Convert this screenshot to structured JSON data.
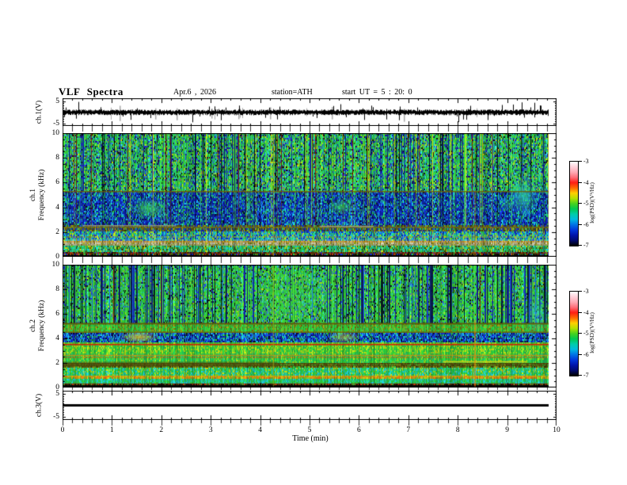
{
  "header": {
    "title": "VLF Spectra",
    "date": "Apr.6 , 2026",
    "station": "station=ATH",
    "start_ut": "start UT =  5 : 20: 0"
  },
  "time_axis": {
    "label": "Time  (min)",
    "min": 0,
    "max": 10,
    "ticks": [
      "0",
      "1",
      "2",
      "3",
      "4",
      "5",
      "6",
      "7",
      "8",
      "9",
      "10"
    ],
    "minor_step_min": 0.2
  },
  "panels": {
    "wave": {
      "ylabel": "ch.1(V)",
      "yticks": [
        "5",
        "-5"
      ],
      "ylim": [
        -5,
        5
      ]
    },
    "sg1": {
      "ylabel_ch": "ch.1",
      "ylabel_axis": "Frequency  (kHz)",
      "yticks": [
        "10",
        "8",
        "6",
        "4",
        "2",
        "0"
      ],
      "ylim": [
        0,
        10
      ]
    },
    "sg2": {
      "ylabel_ch": "ch.2",
      "ylabel_axis": "Frequency  (kHz)",
      "yticks": [
        "10",
        "8",
        "6",
        "4",
        "2",
        "0"
      ],
      "ylim": [
        0,
        10
      ]
    },
    "ch3": {
      "ylabel": "ch.3(V)",
      "yticks": [
        "5",
        "-5"
      ],
      "ylim": [
        -5,
        5
      ]
    }
  },
  "colorbar": {
    "label": "log(PSD)(V²/Hz)",
    "ticks": [
      "-3",
      "-4",
      "-5",
      "-6",
      "-7"
    ],
    "gradient": [
      "#ffffff",
      "#ffd2dc",
      "#ffaab4",
      "#ff6e78",
      "#ff1e14",
      "#ff6a00",
      "#ffd000",
      "#b4e100",
      "#46d21e",
      "#00c850",
      "#00cdaa",
      "#00b9e1",
      "#0073e6",
      "#0037dc",
      "#0014aa",
      "#000a6e",
      "#000000"
    ]
  },
  "chart_data": [
    {
      "id": "ch1_waveform",
      "type": "line",
      "ylabel": "ch.1(V)",
      "xlim": [
        0,
        10
      ],
      "ylim": [
        -5,
        5
      ],
      "description": "Broadband noise around 0 V, ~±1 V, with impulsive spikes to ±4 V and grey saturation bars; data ends at ~9.85 min",
      "seed": 303,
      "gray_spikes_t": [
        1.15,
        1.87,
        2.3,
        3.02,
        3.55,
        4.2,
        5.45,
        6.9
      ],
      "down_spikes_t": [
        2.63,
        3.2,
        4.35,
        6.55,
        8.02,
        8.6
      ],
      "up_spikes_t": [
        0.32,
        5.62,
        8.9,
        9.12,
        9.3,
        9.55,
        9.67
      ]
    },
    {
      "id": "ch1_spectrogram",
      "type": "heatmap",
      "xlim": [
        0,
        10
      ],
      "ylim": [
        0,
        10
      ],
      "colorbar_ticks": [
        -3,
        -4,
        -5,
        -6,
        -7
      ],
      "seed": 101,
      "tint_below": 2.7,
      "tint_colors": [
        "#cdd210",
        "#e08410",
        "#c2c2a0",
        "#222208"
      ],
      "bands": [
        {
          "range": [
            5.3,
            10
          ],
          "colors": [
            "#26bd3a",
            "#26bd3a",
            "#31cc49",
            "#1fb257",
            "#3fd12e",
            "#22c08a",
            "#22c08a",
            "#2fc7cf",
            "#b8cf14",
            "#2a3bd6",
            "#15169b",
            "#101010"
          ]
        },
        {
          "range": [
            2.62,
            5.3
          ],
          "colors": [
            "#1330cc",
            "#1330cc",
            "#0d22a8",
            "#0a1880",
            "#1545e0",
            "#0a0a28",
            "#17a3e8",
            "#1bc0d9",
            "#19b877",
            "#27c23e",
            "#0d22a8",
            "#0a1880"
          ]
        },
        {
          "range": [
            2.15,
            2.62
          ],
          "colors": [
            "#6b6b10",
            "#55500d",
            "#3d3a08",
            "#1330cc",
            "#0d22a8",
            "#9aa016",
            "#14b86e"
          ]
        },
        {
          "range": [
            1.3,
            2.15
          ],
          "colors": [
            "#1cc3cf",
            "#24c774",
            "#2bd13f",
            "#1545e0",
            "#0d22a8",
            "#17a3e8",
            "#b8cf14"
          ]
        },
        {
          "range": [
            0.95,
            1.3
          ],
          "colors": [
            "#a8a884",
            "#b5b59a",
            "#8f8f62",
            "#9aa016",
            "#c3c3ad",
            "#6b6b10"
          ]
        },
        {
          "range": [
            0.5,
            0.95
          ],
          "colors": [
            "#27c23e",
            "#1fb257",
            "#22c08a",
            "#b8cf14",
            "#1cc3cf",
            "#3d3a08"
          ]
        },
        {
          "range": [
            0.22,
            0.5
          ],
          "colors": [
            "#141404",
            "#2a2a06",
            "#101010",
            "#6b6b10",
            "#27c23e",
            "#cc3a10",
            "#1330cc"
          ]
        },
        {
          "range": [
            0,
            0.22
          ],
          "colors": [
            "#000000",
            "#000000",
            "#0a0a00"
          ]
        }
      ],
      "stripes": [
        {
          "p": 0.05,
          "c": "#000000"
        },
        {
          "p": 0.11,
          "c": "#0d1190"
        },
        {
          "p": 0.16,
          "c": "#49e03c"
        },
        {
          "p": 0.19,
          "c": "#c9d112"
        },
        {
          "p": 0.215,
          "c": "#7a1608"
        }
      ],
      "stripe_zones": [
        {
          "f0": 5.3,
          "f1": 10,
          "a": 0.9
        },
        {
          "f0": 2.62,
          "f1": 5.3,
          "a": 0.55
        },
        {
          "f0": 0.5,
          "f1": 2.62,
          "a": 0.3,
          "p": 0.35
        }
      ],
      "hlines": [
        {
          "f": 5.27,
          "color": "#6f5f08",
          "a": 0.9,
          "w": 1.5
        },
        {
          "f": 2.38,
          "color": "#7a6c0a",
          "a": 0.85,
          "w": 1.5
        },
        {
          "f": 2.52,
          "color": "#9c9c80",
          "a": 0.8,
          "w": 1.5,
          "t": [
            0.4,
            2.3
          ]
        },
        {
          "f": 2.45,
          "color": "#a8a88e",
          "a": 0.8,
          "w": 1.5,
          "t": [
            5.2,
            6.3
          ]
        },
        {
          "f": 0.95,
          "color": "#8f8f62",
          "a": 0.6,
          "w": 1
        },
        {
          "f": 0.3,
          "color": "#8a1c06",
          "a": 0.7,
          "w": 1
        }
      ],
      "vlines": [
        {
          "t": 4.27,
          "color": "#b9bf10",
          "a": 0.55
        },
        {
          "t": 8.35,
          "color": "#b96a10",
          "a": 0.5,
          "f": [
            0,
            5.3
          ]
        }
      ],
      "blobs": [
        {
          "t": 1.75,
          "f": 3.9,
          "rt": 0.38,
          "rf": 0.9,
          "color": "#3bdc52",
          "a": 0.75
        },
        {
          "t": 5.65,
          "f": 4.05,
          "rt": 0.3,
          "rf": 0.65,
          "color": "#3bdc52",
          "a": 0.7
        },
        {
          "t": 9.33,
          "f": 5.0,
          "rt": 0.33,
          "rf": 1.9,
          "color": "#2fd2a0",
          "a": 0.8
        },
        {
          "t": 9.0,
          "f": 4.2,
          "rt": 0.15,
          "rf": 0.5,
          "color": "#2fd2a0",
          "a": 0.5
        }
      ]
    },
    {
      "id": "ch2_spectrogram",
      "type": "heatmap",
      "xlim": [
        0,
        10
      ],
      "ylim": [
        0,
        10
      ],
      "colorbar_ticks": [
        -3,
        -4,
        -5,
        -6,
        -7
      ],
      "seed": 202,
      "tint_below": 5.3,
      "tint_colors": [
        "#cdd210",
        "#e08410",
        "#d4420a",
        "#2f2f0a"
      ],
      "bands": [
        {
          "range": [
            5.35,
            10
          ],
          "colors": [
            "#2cc23a",
            "#2cc23a",
            "#2cc23a",
            "#38cf2e",
            "#22b84e",
            "#45d63c",
            "#2cc23a",
            "#9fd31c",
            "#22c08a",
            "#2fc7cf",
            "#2a3bd6",
            "#101010"
          ]
        },
        {
          "range": [
            4.55,
            5.35
          ],
          "colors": [
            "#2cc23a",
            "#38cf2e",
            "#6b6b10",
            "#22b84e",
            "#9aa016",
            "#2cc23a"
          ]
        },
        {
          "range": [
            3.7,
            4.55
          ],
          "colors": [
            "#1330cc",
            "#0d22a8",
            "#1545e0",
            "#17a3e8",
            "#1bc0d9",
            "#0a1880",
            "#27c23e",
            "#0a0a28"
          ]
        },
        {
          "range": [
            3.45,
            3.7
          ],
          "colors": [
            "#2cc23a",
            "#9fd31c",
            "#38cf2e"
          ]
        },
        {
          "range": [
            2.8,
            3.45
          ],
          "colors": [
            "#2cc23a",
            "#9fd31c",
            "#b8cf14",
            "#38cf2e",
            "#22b84e"
          ]
        },
        {
          "range": [
            2.1,
            2.8
          ],
          "colors": [
            "#2cc23a",
            "#38cf2e",
            "#22b84e",
            "#1fc06e",
            "#9fd31c"
          ]
        },
        {
          "range": [
            1.7,
            2.1
          ],
          "colors": [
            "#55500d",
            "#6b6b10",
            "#3d3a08",
            "#2cc23a",
            "#9aa016"
          ]
        },
        {
          "range": [
            1.05,
            1.7
          ],
          "colors": [
            "#27c23e",
            "#1cc3cf",
            "#2cc23a",
            "#22c08a",
            "#b8cf14"
          ]
        },
        {
          "range": [
            0.8,
            1.05
          ],
          "colors": [
            "#d6a410",
            "#c97a10",
            "#b8cf14",
            "#2cc23a",
            "#e8630e"
          ]
        },
        {
          "range": [
            0.45,
            0.8
          ],
          "colors": [
            "#27c23e",
            "#1cc3cf",
            "#22c08a",
            "#2cc23a"
          ]
        },
        {
          "range": [
            0.22,
            0.45
          ],
          "colors": [
            "#141404",
            "#2a2a06",
            "#101010",
            "#6b6b10",
            "#27c23e",
            "#cc3a10"
          ]
        },
        {
          "range": [
            0,
            0.22
          ],
          "colors": [
            "#000000",
            "#000000",
            "#0a0a00"
          ]
        }
      ],
      "stripes": [
        {
          "p": 0.09,
          "c": "#000a14"
        },
        {
          "p": 0.21,
          "c": "#0d1190"
        },
        {
          "p": 0.27,
          "c": "#1545e0"
        },
        {
          "p": 0.31,
          "c": "#49e03c"
        },
        {
          "p": 0.325,
          "c": "#7a1608"
        }
      ],
      "stripe_zones": [
        {
          "f0": 5.35,
          "f1": 10,
          "a": 0.9
        },
        {
          "f0": 0.5,
          "f1": 5.35,
          "a": 0.12,
          "p": 0.3
        }
      ],
      "calm": [
        [
          3.85,
          5.3,
          0.25
        ]
      ],
      "blocks": [
        {
          "t": [
            0,
            4.35
          ],
          "f": [
            1.7,
            2.1
          ],
          "color": "#4f4a0c",
          "a": 0.5
        }
      ],
      "hlines": [
        {
          "f": 5.2,
          "color": "#5f5408",
          "a": 0.9,
          "w": 2
        },
        {
          "f": 4.5,
          "color": "#6f5f08",
          "a": 0.85,
          "w": 1.5
        },
        {
          "f": 3.5,
          "color": "#d41607",
          "a": 0.9,
          "w": 1.8
        },
        {
          "f": 2.62,
          "color": "#e07e0e",
          "a": 0.8,
          "w": 1.2
        },
        {
          "f": 2.1,
          "color": "#d6cf10",
          "a": 0.8,
          "w": 2,
          "t": [
            7.7,
            9.4
          ]
        },
        {
          "f": 1.95,
          "color": "#4a4408",
          "a": 0.9,
          "w": 1.4
        },
        {
          "f": 1.78,
          "color": "#4a4408",
          "a": 0.8,
          "w": 1.2
        },
        {
          "f": 0.92,
          "color": "#d6a410",
          "a": 0.7,
          "w": 1.2
        },
        {
          "f": 0.3,
          "color": "#8a1c06",
          "a": 0.6,
          "w": 1
        }
      ],
      "vlines": [
        {
          "t": 4.27,
          "color": "#b9bf10",
          "a": 0.45
        },
        {
          "t": 8.35,
          "color": "#e8820e",
          "a": 0.75,
          "f": [
            0,
            5.5
          ]
        }
      ],
      "blobs": [
        {
          "t": 1.55,
          "f": 4.1,
          "rt": 0.4,
          "rf": 0.5,
          "color": "#e8d714",
          "a": 0.8
        },
        {
          "t": 5.7,
          "f": 4.1,
          "rt": 0.35,
          "rf": 0.55,
          "color": "#cfe014",
          "a": 0.6
        },
        {
          "t": 4.6,
          "f": 7.5,
          "rt": 0.7,
          "rf": 2.5,
          "color": "#45d63c",
          "a": 0.35
        },
        {
          "t": 9.6,
          "f": 6.0,
          "rt": 0.25,
          "rf": 2.0,
          "color": "#2fc7cf",
          "a": 0.5
        }
      ]
    },
    {
      "id": "ch3_waveform",
      "type": "line",
      "ylabel": "ch.3(V)",
      "xlim": [
        0,
        10
      ],
      "ylim": [
        -5,
        5
      ],
      "description": "Constant flat signal at 0 V (thick black line) out to ~9.85 min",
      "value": 0
    }
  ]
}
